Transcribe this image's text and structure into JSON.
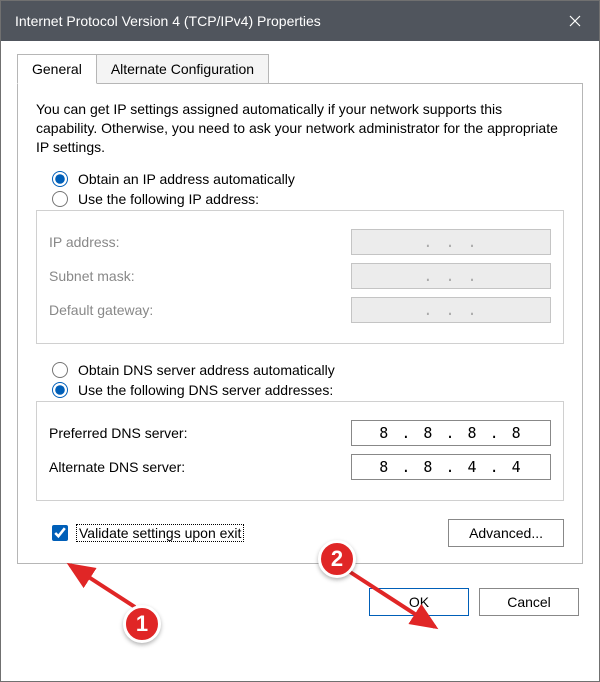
{
  "titlebar": {
    "title": "Internet Protocol Version 4 (TCP/IPv4) Properties"
  },
  "tabs": {
    "general": "General",
    "alternate": "Alternate Configuration"
  },
  "description": "You can get IP settings assigned automatically if your network supports this capability. Otherwise, you need to ask your network administrator for the appropriate IP settings.",
  "ip_section": {
    "radio_auto": "Obtain an IP address automatically",
    "radio_manual": "Use the following IP address:",
    "ip_label": "IP address:",
    "ip_value": ".      .      .",
    "subnet_label": "Subnet mask:",
    "subnet_value": ".      .      .",
    "gateway_label": "Default gateway:",
    "gateway_value": ".      .      ."
  },
  "dns_section": {
    "radio_auto": "Obtain DNS server address automatically",
    "radio_manual": "Use the following DNS server addresses:",
    "preferred_label": "Preferred DNS server:",
    "preferred_value": "8 . 8 . 8 . 8",
    "alternate_label": "Alternate DNS server:",
    "alternate_value": "8 . 8 . 4 . 4"
  },
  "validate_label": "Validate settings upon exit",
  "advanced_label": "Advanced...",
  "buttons": {
    "ok": "OK",
    "cancel": "Cancel"
  },
  "annotations": {
    "a1": "1",
    "a2": "2"
  }
}
